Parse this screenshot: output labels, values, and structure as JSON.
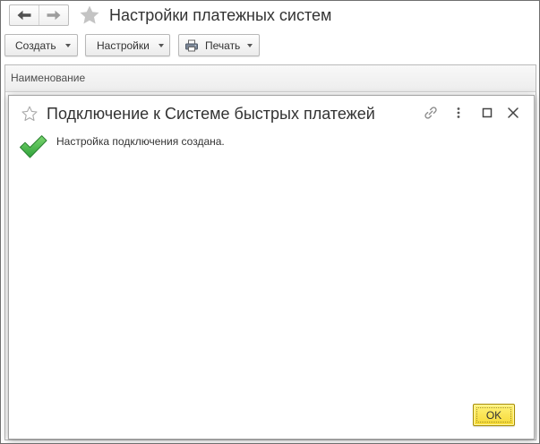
{
  "window": {
    "title": "Настройки платежных систем"
  },
  "navigation": {
    "back_icon": "back-arrow-icon",
    "forward_icon": "forward-arrow-icon",
    "favorite_icon": "star-icon"
  },
  "toolbar": {
    "create_label": "Создать",
    "settings_label": "Настройки",
    "print_label": "Печать",
    "print_icon": "printer-icon",
    "dropdown_icon": "dropdown-arrow-icon"
  },
  "table": {
    "columns": [
      "Наименование"
    ]
  },
  "dialog": {
    "title": "Подключение к Системе быстрых платежей",
    "message": "Настройка подключения создана.",
    "ok_label": "OK",
    "icons": {
      "favorite": "star-outline-icon",
      "link": "link-icon",
      "more": "more-vertical-icon",
      "maximize": "maximize-icon",
      "close": "close-icon",
      "status": "success-check-icon"
    }
  },
  "colors": {
    "ok_button": "#f6d934",
    "success": "#46b34a",
    "text": "#333333",
    "border": "#b8b8b8"
  }
}
